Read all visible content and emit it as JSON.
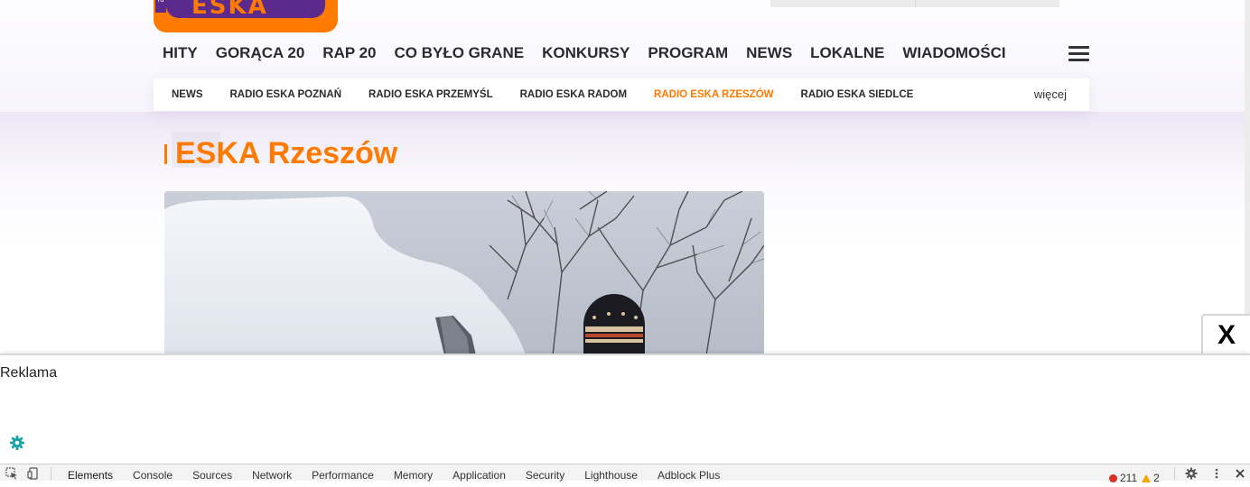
{
  "logo": {
    "text": "ESKA",
    "tag": "rd"
  },
  "main_nav": {
    "items": [
      "HITY",
      "GORĄCA 20",
      "RAP 20",
      "CO BYŁO GRANE",
      "KONKURSY",
      "PROGRAM",
      "NEWS",
      "LOKALNE",
      "WIADOMOŚCI"
    ]
  },
  "sub_nav": {
    "items": [
      "NEWS",
      "RADIO ESKA POZNAŃ",
      "RADIO ESKA PRZEMYŚL",
      "RADIO ESKA RADOM",
      "RADIO ESKA RZESZÓW",
      "RADIO ESKA SIEDLCE"
    ],
    "active_index": 4,
    "more_label": "więcej"
  },
  "page": {
    "title": "ESKA Rzeszów"
  },
  "ad": {
    "label": "Reklama",
    "close_label": "X"
  },
  "devtools": {
    "tabs": [
      "Elements",
      "Console",
      "Sources",
      "Network",
      "Performance",
      "Memory",
      "Application",
      "Security",
      "Lighthouse",
      "Adblock Plus"
    ],
    "active_tab": "Elements",
    "error_count": "211",
    "warning_count": "2"
  },
  "colors": {
    "accent": "#ff7a00",
    "brand_purple": "#5b2a8c",
    "gear_teal": "#15a3a8"
  }
}
